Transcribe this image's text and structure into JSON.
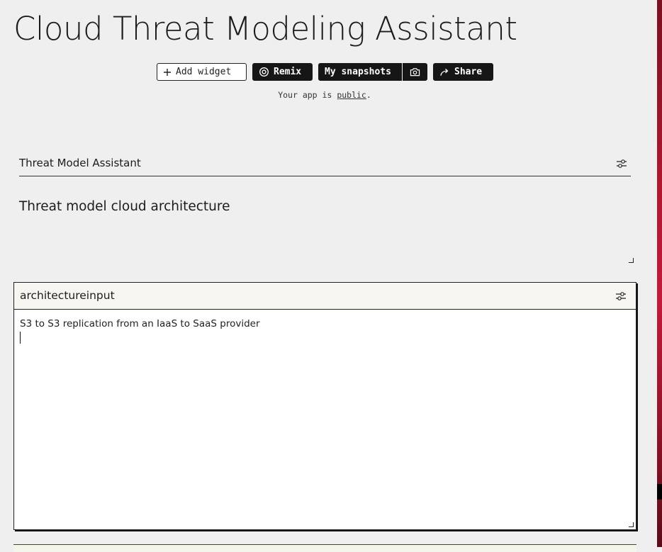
{
  "app": {
    "title": "Cloud Threat Modeling Assistant"
  },
  "toolbar": {
    "add_widget": "Add widget",
    "remix": "Remix",
    "snapshots": "My snapshots",
    "share": "Share"
  },
  "visibility": {
    "prefix": "Your app is",
    "status": "public",
    "suffix": "."
  },
  "widgets": [
    {
      "title": "Threat Model Assistant",
      "body": "Threat model cloud architecture"
    },
    {
      "title": "architectureinput",
      "value": "S3 to S3 replication from an IaaS to SaaS provider"
    }
  ],
  "icons": {
    "add": "plus-icon",
    "remix": "remix-icon",
    "snapshot": "camera-icon",
    "share": "share-arrow-icon",
    "settings": "sliders-icon"
  },
  "colors": {
    "dark_button": "#161616",
    "background": "#efefef"
  }
}
